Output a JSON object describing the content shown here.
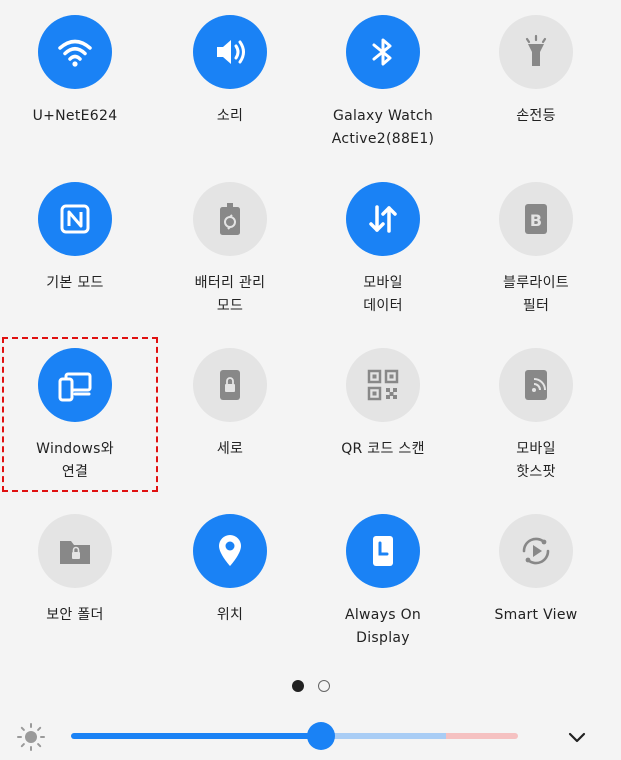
{
  "tiles": [
    {
      "id": "wifi",
      "icon": "wifi-icon",
      "active": true,
      "lines": [
        "U+NetE624"
      ]
    },
    {
      "id": "sound",
      "icon": "speaker-icon",
      "active": true,
      "lines": [
        "소리"
      ]
    },
    {
      "id": "bluetooth",
      "icon": "bluetooth-icon",
      "active": true,
      "lines": [
        "Galaxy Watch",
        "Active2(88E1)"
      ]
    },
    {
      "id": "flashlight",
      "icon": "flashlight-icon",
      "active": false,
      "lines": [
        "손전등"
      ]
    },
    {
      "id": "nfc",
      "icon": "nfc-icon",
      "active": true,
      "lines": [
        "기본 모드"
      ]
    },
    {
      "id": "battery",
      "icon": "battery-icon",
      "active": false,
      "lines": [
        "배터리 관리",
        "모드"
      ]
    },
    {
      "id": "mobile-data",
      "icon": "data-arrows-icon",
      "active": true,
      "lines": [
        "모바일",
        "데이터"
      ]
    },
    {
      "id": "bluelight",
      "icon": "bluelight-icon",
      "active": false,
      "lines": [
        "블루라이트",
        "필터"
      ]
    },
    {
      "id": "link-windows",
      "icon": "link-to-windows-icon",
      "active": true,
      "lines": [
        "Windows와",
        "연결"
      ]
    },
    {
      "id": "rotation",
      "icon": "portrait-lock-icon",
      "active": false,
      "lines": [
        "세로"
      ]
    },
    {
      "id": "qr",
      "icon": "qr-code-icon",
      "active": false,
      "lines": [
        "QR 코드 스캔"
      ]
    },
    {
      "id": "hotspot",
      "icon": "hotspot-icon",
      "active": false,
      "lines": [
        "모바일",
        "핫스팟"
      ]
    },
    {
      "id": "secure-folder",
      "icon": "secure-folder-icon",
      "active": false,
      "lines": [
        "보안 폴더"
      ]
    },
    {
      "id": "location",
      "icon": "location-pin-icon",
      "active": true,
      "lines": [
        "위치"
      ]
    },
    {
      "id": "always-on",
      "icon": "always-on-display-icon",
      "active": true,
      "lines": [
        "Always On",
        "Display"
      ]
    },
    {
      "id": "smart-view",
      "icon": "smart-view-icon",
      "active": false,
      "lines": [
        "Smart View"
      ]
    }
  ],
  "pages": {
    "count": 2,
    "current": 0
  },
  "brightness": {
    "level": 0.56
  },
  "colors": {
    "active": "#1a82f5",
    "inactive": "#e4e4e4",
    "inactive_icon": "#888888"
  }
}
